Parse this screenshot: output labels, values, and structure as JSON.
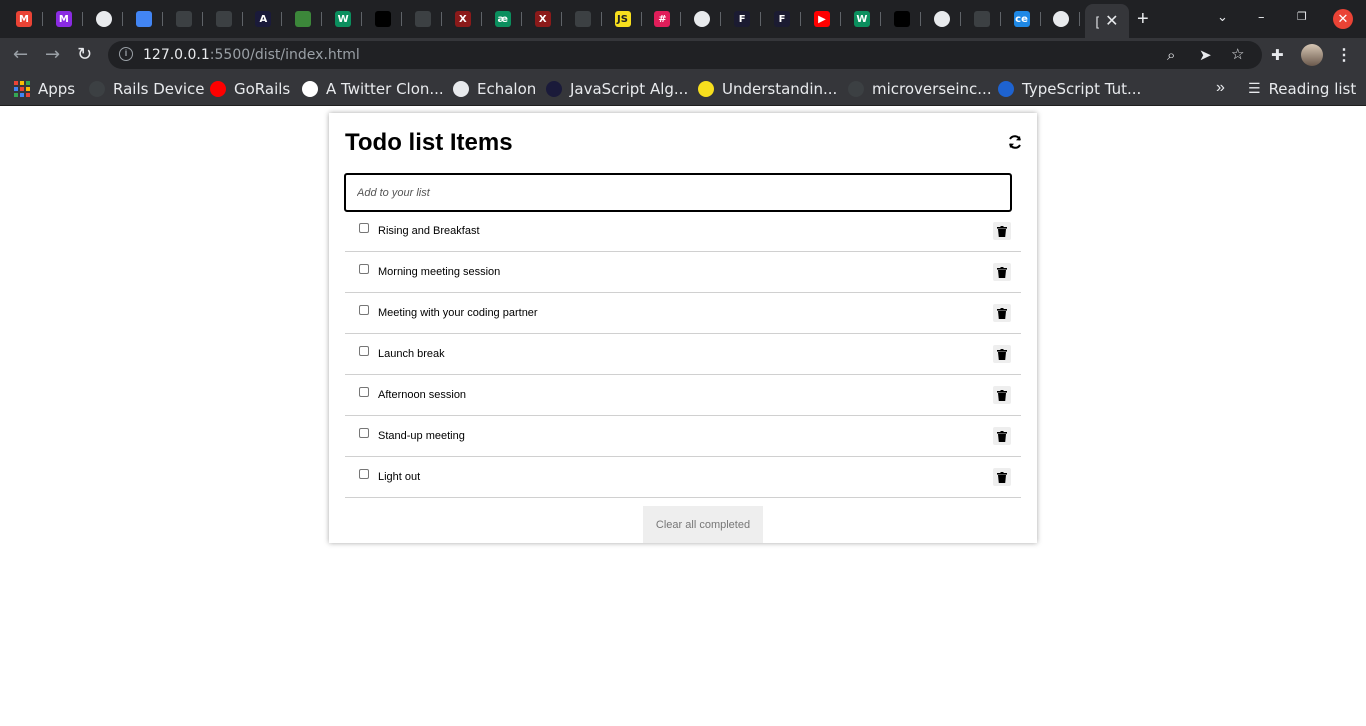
{
  "browser": {
    "tabs": [
      {
        "icon": "gmail-icon",
        "letter": "M",
        "color": "#ea4335"
      },
      {
        "icon": "miro-icon",
        "letter": "M",
        "color": "#8a2be2"
      },
      {
        "icon": "globe-icon",
        "letter": "",
        "color": "#e8eaed"
      },
      {
        "icon": "docs-icon",
        "letter": "",
        "color": "#4285f4"
      },
      {
        "icon": "github-icon",
        "letter": "",
        "color": "#3c4043"
      },
      {
        "icon": "github-icon",
        "letter": "",
        "color": "#3c4043"
      },
      {
        "icon": "jsalgo-icon",
        "letter": "A",
        "color": "#1a1a3a"
      },
      {
        "icon": "node-icon",
        "letter": "",
        "color": "#3c873a"
      },
      {
        "icon": "w-icon",
        "letter": "W",
        "color": "#0b8f5e"
      },
      {
        "icon": "codecov-icon",
        "letter": "",
        "color": "#000000"
      },
      {
        "icon": "github-icon",
        "letter": "",
        "color": "#3c4043"
      },
      {
        "icon": "x-icon",
        "letter": "X",
        "color": "#8b1a1a"
      },
      {
        "icon": "ae-icon",
        "letter": "æ",
        "color": "#0b8f5e"
      },
      {
        "icon": "x-icon",
        "letter": "X",
        "color": "#8b1a1a"
      },
      {
        "icon": "github-icon",
        "letter": "",
        "color": "#3c4043"
      },
      {
        "icon": "js-icon",
        "letter": "JS",
        "color": "#f7df1e"
      },
      {
        "icon": "slack-icon",
        "letter": "#",
        "color": "#e01e5a"
      },
      {
        "icon": "globe-icon",
        "letter": "",
        "color": "#e8eaed"
      },
      {
        "icon": "fcc-icon",
        "letter": "F",
        "color": "#1b1b32"
      },
      {
        "icon": "fcc-icon",
        "letter": "F",
        "color": "#1b1b32"
      },
      {
        "icon": "youtube-icon",
        "letter": "▶",
        "color": "#ff0000"
      },
      {
        "icon": "w-icon",
        "letter": "W",
        "color": "#0b8f5e"
      },
      {
        "icon": "codecov-icon",
        "letter": "",
        "color": "#000000"
      },
      {
        "icon": "globe-icon",
        "letter": "",
        "color": "#e8eaed"
      },
      {
        "icon": "github-icon",
        "letter": "",
        "color": "#3c4043"
      },
      {
        "icon": "ce-icon",
        "letter": "ce",
        "color": "#1e88e5"
      },
      {
        "icon": "globe-icon",
        "letter": "",
        "color": "#e8eaed"
      }
    ],
    "active_tab_title": "[",
    "url_host": "127.0.0.1",
    "url_rest": ":5500/dist/index.html",
    "bookmarks": [
      {
        "label": "Apps",
        "icon": "apps-grid-icon"
      },
      {
        "label": "Rails Device",
        "icon": "github-icon",
        "color": "#3c4043"
      },
      {
        "label": "GoRails",
        "icon": "youtube-icon",
        "color": "#ff0000"
      },
      {
        "label": "A Twitter Clon...",
        "icon": "badge-icon",
        "color": "#ffffff"
      },
      {
        "label": "Echalon",
        "icon": "globe-icon",
        "color": "#e8eaed"
      },
      {
        "label": "JavaScript Alg...",
        "icon": "jsalgo-icon",
        "color": "#1a1a3a"
      },
      {
        "label": "Understandin...",
        "icon": "js-icon",
        "color": "#f7df1e"
      },
      {
        "label": "microverseinc...",
        "icon": "github-icon",
        "color": "#3c4043"
      },
      {
        "label": "TypeScript Tut...",
        "icon": "ts-icon",
        "color": "#1e63d0"
      }
    ],
    "reading_list": "Reading list"
  },
  "todo": {
    "title": "Todo list Items",
    "input_placeholder": "Add to your list",
    "items": [
      {
        "label": "Rising and Breakfast",
        "completed": false
      },
      {
        "label": "Morning meeting session",
        "completed": false
      },
      {
        "label": "Meeting with your coding partner",
        "completed": false
      },
      {
        "label": "Launch break",
        "completed": false
      },
      {
        "label": "Afternoon session",
        "completed": false
      },
      {
        "label": "Stand-up meeting",
        "completed": false
      },
      {
        "label": "Light out",
        "completed": false
      }
    ],
    "clear_label": "Clear all completed"
  }
}
